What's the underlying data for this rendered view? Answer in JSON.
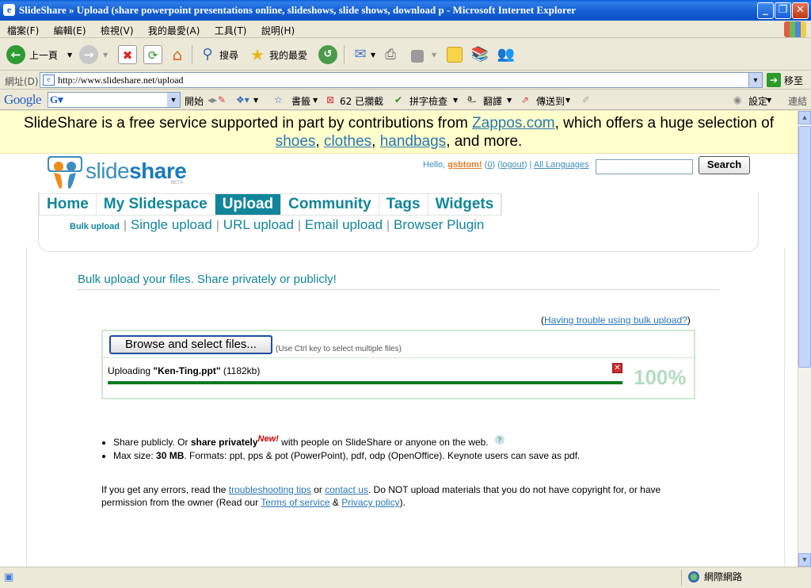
{
  "window": {
    "title": "SlideShare » Upload (share powerpoint presentations online, slideshows, slide shows, download p - Microsoft Internet Explorer"
  },
  "menu": [
    "檔案(F)",
    "編輯(E)",
    "檢視(V)",
    "我的最愛(A)",
    "工具(T)",
    "說明(H)"
  ],
  "toolbar": {
    "back": "上一頁",
    "search": "搜尋",
    "favorites": "我的最愛"
  },
  "address": {
    "label": "網址(D)",
    "url": "http://www.slideshare.net/upload",
    "go": "移至"
  },
  "google_toolbar": {
    "logo": "Google",
    "start": "開始",
    "bookmarks": "書籤",
    "blocked": "62 已攔截",
    "spellcheck": "拼字檢查",
    "translate": "翻譯",
    "sendto": "傳送到",
    "settings": "設定",
    "links": "連結"
  },
  "status": {
    "zone": "網際網路"
  },
  "promo": {
    "prefix": "SlideShare is a free service supported in part by contributions from ",
    "zappos": "Zappos.com",
    "middle": ", which offers a huge selection of ",
    "shoes": "shoes",
    "comma1": ", ",
    "clothes": "clothes",
    "comma2": ", ",
    "handbags": "handbags",
    "suffix": ", and more."
  },
  "header": {
    "logo_light": "slide",
    "logo_bold": "share",
    "logo_beta": "BETA",
    "hello": "Hello, ",
    "username": "gsbtom!",
    "inbox_open": " (",
    "inbox": "0",
    "inbox_close": ") (",
    "logout": "logout",
    "logout_close": ") | ",
    "languages": "All Languages",
    "search_button": "Search"
  },
  "nav": {
    "tabs": [
      "Home",
      "My Slidespace",
      "Upload",
      "Community",
      "Tags",
      "Widgets"
    ],
    "active_tab": "Upload",
    "sub": {
      "bulk": "Bulk upload",
      "single": "Single upload",
      "url": "URL upload",
      "email": "Email upload",
      "browser": "Browser Plugin"
    }
  },
  "upload": {
    "title": "Bulk upload your files. Share privately or publicly!",
    "help_open": "(",
    "help_link": "Having trouble using bulk upload?",
    "help_close": ")",
    "browse_button": "Browse and select files...",
    "browse_hint": "(Use Ctrl key to select multiple files)",
    "uploading_prefix": "Uploading ",
    "file_name": "\"Ken-Ting.ppt\"",
    "file_size": " (1182kb)",
    "progress_percent": 100,
    "progress_label": "100%"
  },
  "info": {
    "bullet1_pre": "Share publicly. Or ",
    "bullet1_bold": "share privately",
    "bullet1_new": "New!",
    "bullet1_post": " with people on SlideShare or anyone on the web.",
    "help_q": "?",
    "bullet2_pre": "Max size: ",
    "bullet2_bold": "30 MB",
    "bullet2_post": ". Formats: ppt, pps & pot (PowerPoint), pdf, odp (OpenOffice). Keynote users can save as pdf."
  },
  "footer": {
    "t1": "If you get any errors, read the ",
    "troubleshooting": "troubleshooting tips",
    "t2": " or ",
    "contact": "contact us",
    "t3": ". Do NOT upload materials that you do not have copyright for, or have permission from the owner (Read our ",
    "terms": "Terms of service",
    "t4": " & ",
    "privacy": "Privacy policy",
    "t5": ")."
  },
  "colors": {
    "accent": "#11869a",
    "link": "#2a76b6",
    "progress": "#0a7a1f",
    "promo_bg": "#ffffcc"
  }
}
